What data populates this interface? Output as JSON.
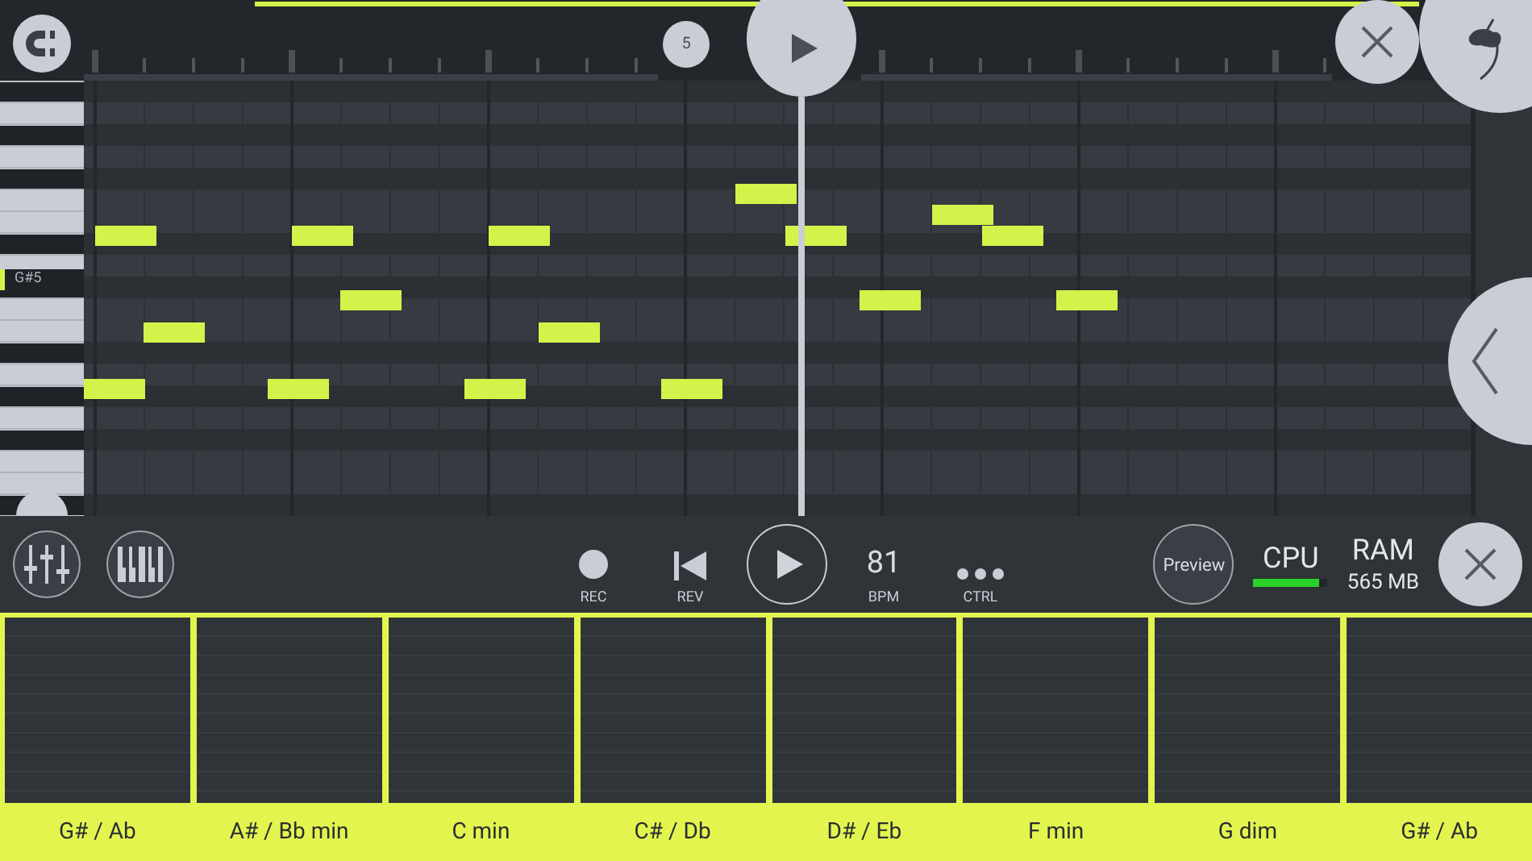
{
  "timeline": {
    "marker": "5"
  },
  "piano_roll": {
    "key_label": "G#5"
  },
  "transport": [
    {
      "kind": "record",
      "label": "REC"
    },
    {
      "kind": "rewind",
      "label": "REV"
    },
    {
      "kind": "play"
    },
    {
      "kind": "value",
      "value": "81",
      "label": "BPM"
    },
    {
      "kind": "dots",
      "label": "CTRL"
    }
  ],
  "preview_button": "Preview",
  "cpu": {
    "label": "CPU",
    "level": 0.88
  },
  "ram": {
    "label": "RAM",
    "value": "565 MB"
  },
  "pads": [
    {
      "label": "G# / Ab"
    },
    {
      "label": "A# / Bb min"
    },
    {
      "label": "C min"
    },
    {
      "label": "C# / Db"
    },
    {
      "label": "D# / Eb"
    },
    {
      "label": "F min"
    },
    {
      "label": "G dim"
    },
    {
      "label": "G# / Ab"
    }
  ]
}
